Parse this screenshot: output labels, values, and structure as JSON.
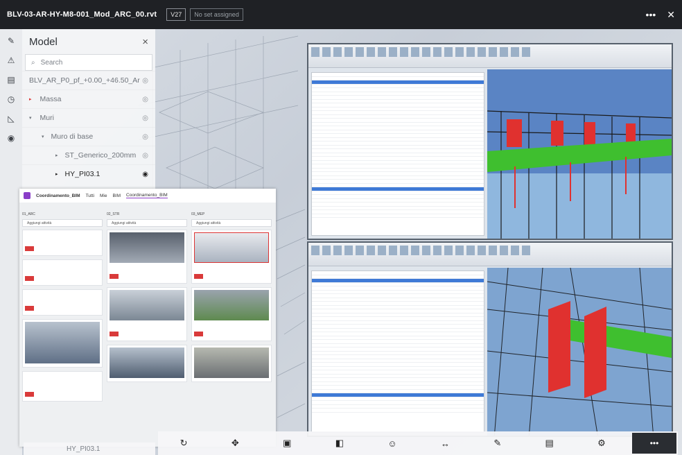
{
  "topbar": {
    "file_name": "BLV-03-AR-HY-M8-001_Mod_ARC_00.rvt",
    "version": "V27",
    "set_label": "No set assigned",
    "more": "•••",
    "close": "✕"
  },
  "model_panel": {
    "title": "Model",
    "close": "×",
    "search_placeholder": "Search",
    "rows": [
      "BLV_AR_P0_pf_+0.00_+46.50_Ar",
      "Massa",
      "Muri",
      "Muro di base",
      "ST_Generico_200mm",
      "HY_PI03.1"
    ]
  },
  "bim": {
    "title": "Coordinamento_BIM",
    "tabs": [
      "Tutti",
      "Mie",
      "BIM",
      "Coordinamento_BIM"
    ],
    "columns": [
      {
        "header": "01_ARC",
        "add": "Aggiungi attività"
      },
      {
        "header": "02_STR",
        "add": "Aggiungi attività"
      },
      {
        "header": "03_MEP",
        "add": "Aggiungi attività"
      }
    ]
  },
  "bottom": {
    "selected": "HY_PI03.1",
    "more": "•••"
  },
  "colors": {
    "accent": "#8a3ec8",
    "clash": "#e0312f",
    "green": "#3fbf2f"
  }
}
